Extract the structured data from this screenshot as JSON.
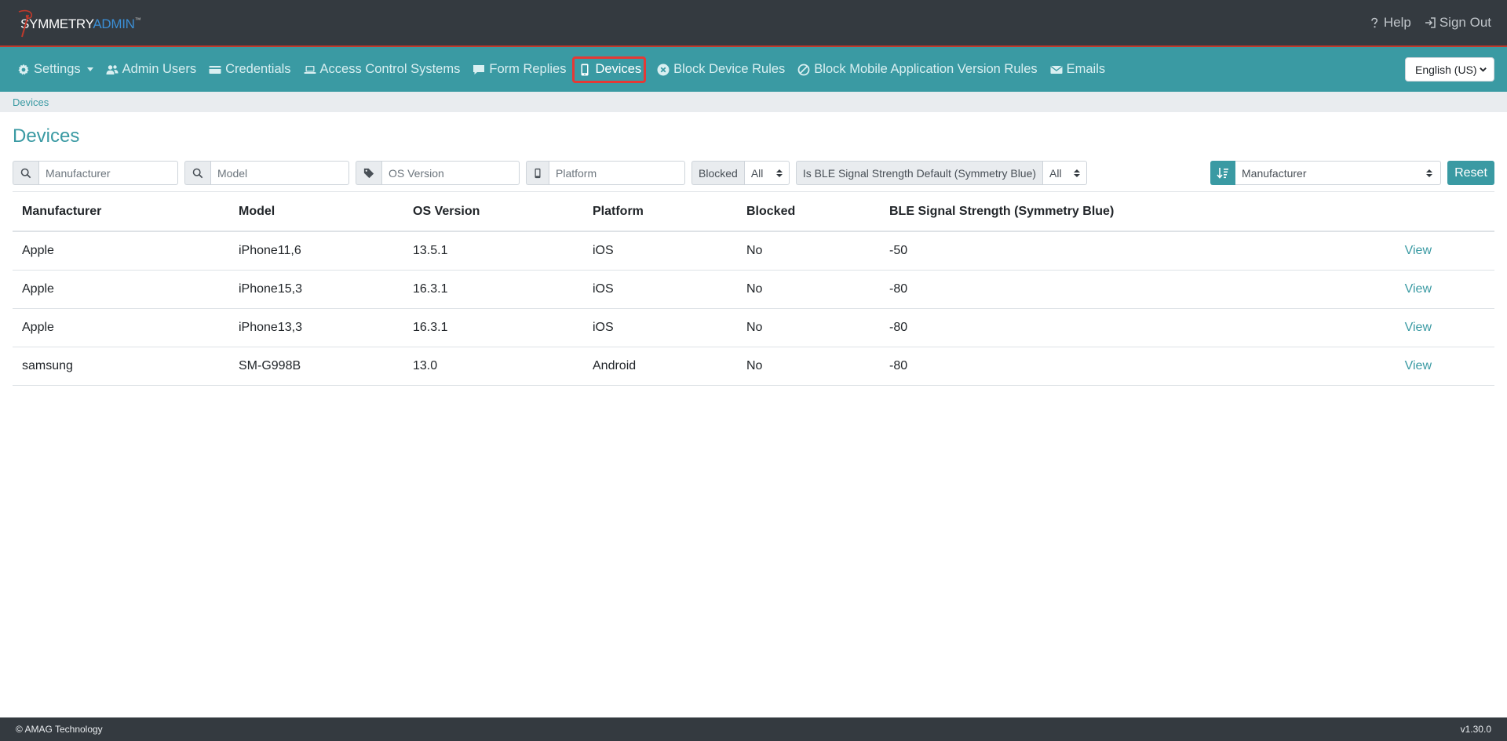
{
  "header": {
    "logo_symmetry": "SYMMETRY",
    "logo_admin": "ADMIN",
    "logo_tm": "™",
    "help_label": "Help",
    "signout_label": "Sign Out"
  },
  "nav": {
    "items": [
      {
        "label": "Settings",
        "icon": "gear-icon",
        "dropdown": true
      },
      {
        "label": "Admin Users",
        "icon": "users-icon"
      },
      {
        "label": "Credentials",
        "icon": "card-icon"
      },
      {
        "label": "Access Control Systems",
        "icon": "laptop-icon"
      },
      {
        "label": "Form Replies",
        "icon": "comment-icon"
      },
      {
        "label": "Devices",
        "icon": "phone-icon",
        "active": true
      },
      {
        "label": "Block Device Rules",
        "icon": "x-circle-icon"
      },
      {
        "label": "Block Mobile Application Version Rules",
        "icon": "ban-icon"
      },
      {
        "label": "Emails",
        "icon": "envelope-icon"
      }
    ],
    "language": "English (US)"
  },
  "breadcrumb": {
    "current": "Devices"
  },
  "page": {
    "title": "Devices"
  },
  "filters": {
    "manufacturer_placeholder": "Manufacturer",
    "model_placeholder": "Model",
    "os_version_placeholder": "OS Version",
    "platform_placeholder": "Platform",
    "blocked_label": "Blocked",
    "blocked_value": "All",
    "ble_label": "Is BLE Signal Strength Default (Symmetry Blue)",
    "ble_value": "All",
    "sort_value": "Manufacturer",
    "reset_label": "Reset"
  },
  "table": {
    "headers": [
      "Manufacturer",
      "Model",
      "OS Version",
      "Platform",
      "Blocked",
      "BLE Signal Strength (Symmetry Blue)"
    ],
    "view_label": "View",
    "rows": [
      [
        "Apple",
        "iPhone11,6",
        "13.5.1",
        "iOS",
        "No",
        "-50"
      ],
      [
        "Apple",
        "iPhone15,3",
        "16.3.1",
        "iOS",
        "No",
        "-80"
      ],
      [
        "Apple",
        "iPhone13,3",
        "16.3.1",
        "iOS",
        "No",
        "-80"
      ],
      [
        "samsung",
        "SM-G998B",
        "13.0",
        "Android",
        "No",
        "-80"
      ]
    ]
  },
  "footer": {
    "copyright": "© AMAG Technology",
    "version": "v1.30.0"
  },
  "colors": {
    "accent": "#3a9aa3",
    "header_bg": "#343a40",
    "active_outline": "#e53935"
  }
}
